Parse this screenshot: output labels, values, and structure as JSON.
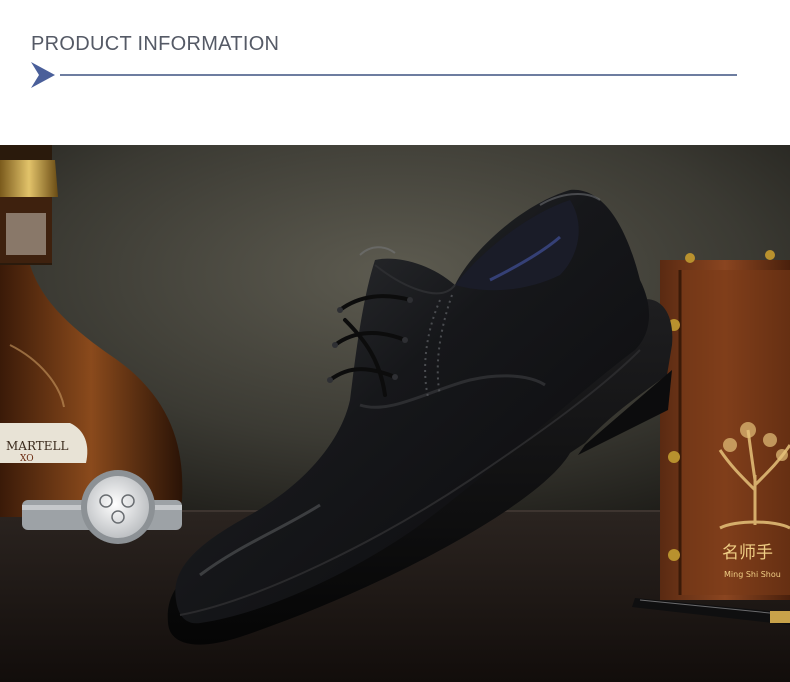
{
  "header": {
    "title": "PRODUCT INFORMATION",
    "arrow_icon": "chevron-right-icon",
    "accent_color": "#4a5f9a",
    "rule_color": "#6d7da0"
  },
  "photo": {
    "bottle_label_brand": "MARTELL",
    "bottle_label_sub": "XO",
    "box_brand_cn": "名师手",
    "box_brand_pinyin": "Ming Shi Shou"
  }
}
